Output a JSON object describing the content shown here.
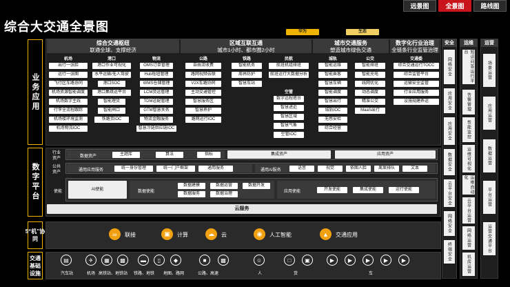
{
  "tabs": [
    {
      "label": "远景图"
    },
    {
      "label": "全景图"
    },
    {
      "label": "路线图"
    }
  ],
  "title": "综合大交通全景图",
  "legend": {
    "huawei": "华为",
    "eco": "生态"
  },
  "sides": {
    "app": "业务应用",
    "digital": "数字平台",
    "collab5": "5“机”协同",
    "infra": "交通基础设施"
  },
  "hubs": {
    "title": "综合交通枢纽",
    "sub": "联通全球、支撑经济"
  },
  "region": {
    "title": "区域互联互通",
    "sub": "城市1小时、都市圈2小时"
  },
  "city": {
    "title": "城市交通服务",
    "sub": "塑造城市绿色交通"
  },
  "industry": {
    "title": "数字化行业治理",
    "sub": "全链条行业监管治理"
  },
  "cols": {
    "airport": {
      "title": "机场",
      "items": [
        "出行一张脸",
        "运行一张图",
        "飞行区车路协同",
        "机场资源智能调度",
        "机场数字主线",
        "行李全流程跟踪",
        "机场楼环境监测",
        "机场物流IOC"
      ]
    },
    "port": {
      "title": "港口",
      "items": [
        "港口作业可视化",
        "水平运输/无人驾驶",
        "港口SOC",
        "港口集疏运平台",
        "智能理货",
        "智能闸口",
        "铁路货IOC"
      ]
    },
    "logistics": {
      "title": "物流",
      "items": [
        "OMS订单管理",
        "Hub枢纽管理",
        "WMS仓储管理",
        "LCM货运管理",
        "TDM运配管理",
        "GTM智慧关务",
        "物流金融服务",
        "智慧冷链供应链IOC"
      ]
    },
    "highway": {
      "title": "公路",
      "items": [
        "自由流收费",
        "路网视频云联",
        "V2X车路协同",
        "主动交通管控",
        "智慧服务区",
        "智慧养护",
        "路网运行IOC"
      ]
    },
    "railway": {
      "title": "铁路",
      "items": [
        "智能机务",
        "周界防护",
        "智慧车站"
      ]
    },
    "civil": {
      "title": "民航",
      "items": [
        "航班机组排班",
        "航班运行大数据分析"
      ]
    },
    "ship": {
      "title": "空管",
      "items": [
        "数字远程塔台",
        "智慧进近",
        "智慧区域",
        "智慧气象",
        "空管IOC"
      ]
    },
    "urban": {
      "title": "城轨",
      "items": [
        "智能运维",
        "智能乘客",
        "智慧车辆",
        "智能调度",
        "智慧出行",
        "城轨IOC",
        "无感安检",
        "综合经营"
      ]
    },
    "bus": {
      "title": "公交",
      "items": [
        "智能排班",
        "智能充电",
        "线网优化",
        "动态调度",
        "精准公交",
        "MaaS出行"
      ]
    },
    "gov": {
      "title": "交通委",
      "items": [
        "综合交通运行TOCC",
        "综合监管平台",
        "运输安全监管",
        "行业应用服务",
        "设施规建养运"
      ]
    }
  },
  "right": {
    "safety": {
      "title": "安全",
      "items": [
        "网络安全",
        "应用安全",
        "数据安全",
        "云平台安全",
        "网络安全",
        "终端安全"
      ]
    },
    "ops": {
      "title": "运维",
      "items": [
        "知识问答运行平台",
        "告警管理",
        "性能监控",
        "运维可视化",
        "运维自动化",
        "云平台运营",
        "网络运营",
        "机房运营"
      ]
    },
    "oper": {
      "title": "运营",
      "items": [
        "场景运营",
        "应用运营",
        "数据运营",
        "平台运营",
        "运营交通平台"
      ]
    }
  },
  "digital": {
    "industry_label": "行业资产",
    "data_asset": "数据资产",
    "assets": [
      "主题库",
      "算法",
      "指标"
    ],
    "integrate": "集成资产",
    "appasset": "应用资产",
    "public_label": "公共资产",
    "appsvc": "通用应用服务",
    "appsvc_items": [
      "统一身份管理",
      "统一门户框架",
      "通用服务"
    ],
    "ai_label": "通用AI服务",
    "ai_items": [
      "语音",
      "视觉",
      "依图人脸",
      "离案排队",
      "文本"
    ],
    "enable_label": "使能",
    "ai_enable": "AI使能",
    "data_enable": "数据使能",
    "data_enable_items": [
      "数据建模",
      "数据运营",
      "数据开发",
      "数据服务",
      "数据治理"
    ],
    "app_enable": "应用使能",
    "app_enable_items": [
      "开发使能",
      "集成使能",
      "运行使能"
    ],
    "cloud": "云服务"
  },
  "collab": [
    {
      "label": "联接",
      "icon": "link-icon"
    },
    {
      "label": "计算",
      "icon": "compute-icon"
    },
    {
      "label": "云",
      "icon": "cloud-icon"
    },
    {
      "label": "人工智能",
      "icon": "ai-icon"
    },
    {
      "label": "交通应用",
      "icon": "traffic-icon"
    }
  ],
  "infra": {
    "items": [
      "汽车站",
      "机场",
      "高铁站、地铁站",
      "铁路、地铁",
      "地图、路网",
      "公路、高速"
    ],
    "people": "人",
    "cargo": "货",
    "vehicle": "车"
  },
  "colors": {
    "accent": "#f0b400",
    "active_tab": "#c8141a"
  }
}
